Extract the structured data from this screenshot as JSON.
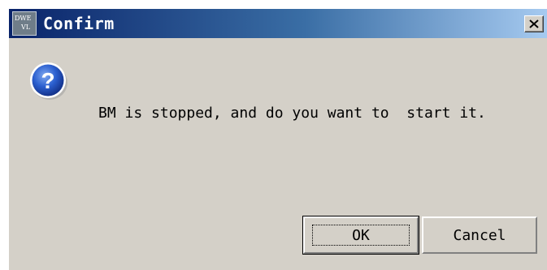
{
  "window": {
    "title": "Confirm",
    "app_icon_text_top": "DWE",
    "app_icon_text_bottom": "VL",
    "app_icon": "application-icon",
    "close_icon": "close-icon",
    "title_gradient": [
      "#0a246a",
      "#a6caf0"
    ],
    "face_color": "#d4d0c8"
  },
  "dialog": {
    "icon": "question-icon",
    "icon_color": "#2b5fcf",
    "message": "BM is stopped, and do you want to  start it."
  },
  "buttons": {
    "ok_label": "OK",
    "cancel_label": "Cancel"
  }
}
